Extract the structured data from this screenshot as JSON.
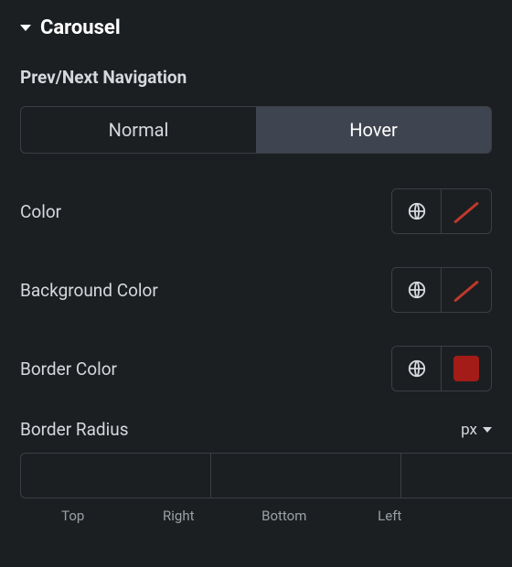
{
  "section": {
    "title": "Carousel"
  },
  "group": {
    "label": "Prev/Next Navigation"
  },
  "state_toggle": {
    "normal": "Normal",
    "hover": "Hover",
    "active": "hover"
  },
  "props": {
    "color": {
      "label": "Color",
      "swatch": "none"
    },
    "background_color": {
      "label": "Background Color",
      "swatch": "none"
    },
    "border_color": {
      "label": "Border Color",
      "swatch": "#a41c17"
    },
    "border_radius": {
      "label": "Border Radius",
      "unit": "px",
      "values": {
        "top": "",
        "right": "",
        "bottom": "",
        "left": ""
      },
      "sides": {
        "top": "Top",
        "right": "Right",
        "bottom": "Bottom",
        "left": "Left"
      },
      "linked": true
    }
  }
}
